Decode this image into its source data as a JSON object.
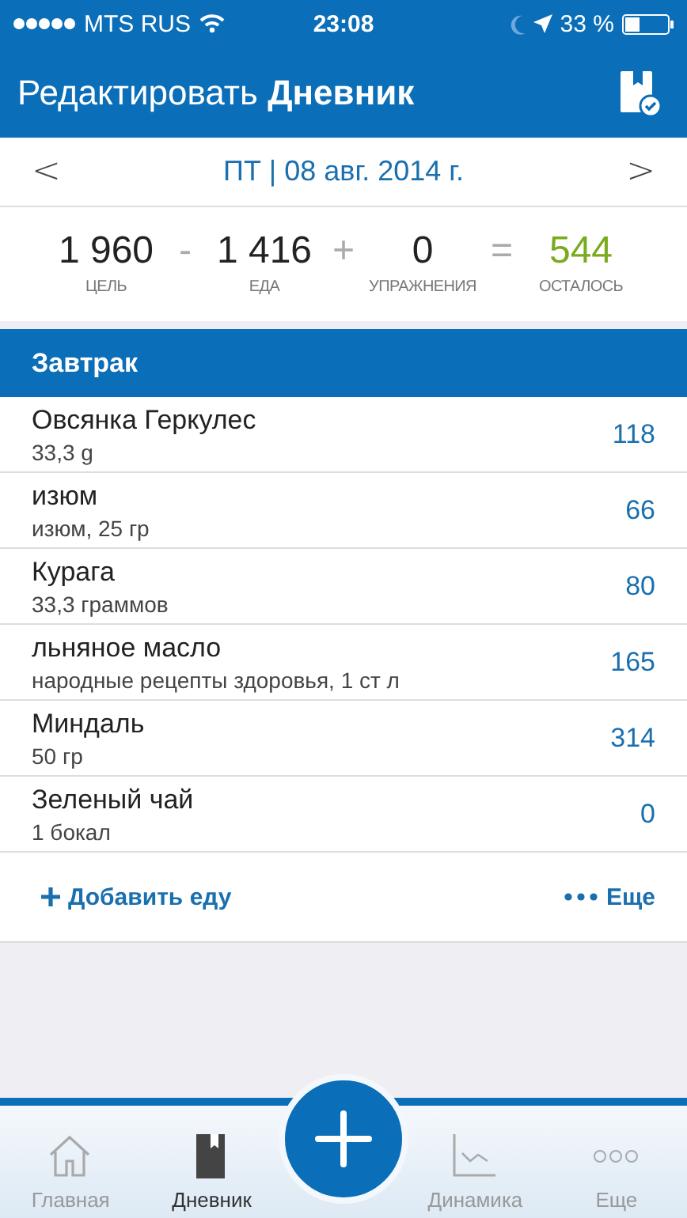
{
  "status_bar": {
    "carrier": "MTS RUS",
    "time": "23:08",
    "battery": "33 %"
  },
  "header": {
    "title": "Редактировать **Дневник**"
  },
  "date_bar": {
    "prev": "<",
    "date": "ПТ | 08 авг. 2014 г.",
    "next": ">"
  },
  "summary": [
    {
      "value": "1 960",
      "label": "ЦЕЛЬ",
      "color": "#222222",
      "operator": "-"
    },
    {
      "value": "1 416",
      "label": "ЕДА",
      "color": "#222222",
      "operator": "+"
    },
    {
      "value": "0",
      "label": "УПРАЖНЕНИЯ",
      "color": "#222222",
      "operator": "="
    },
    {
      "value": "544",
      "label": "ОСТАЛОСЬ",
      "color": "#7aaa1e"
    }
  ],
  "meal": {
    "title": "Завтрак",
    "items": [
      {
        "name": "Овсянка Геркулес",
        "portion": "33,3 g",
        "calories": "118"
      },
      {
        "name": "изюм",
        "portion": "изюм, 25 гр",
        "calories": "66"
      },
      {
        "name": "Курага",
        "portion": "33,3 граммов",
        "calories": "80"
      },
      {
        "name": "льняное масло",
        "portion": "народные рецепты здоровья, 1 ст л",
        "calories": "165"
      },
      {
        "name": "Миндаль",
        "portion": "50 гр",
        "calories": "314"
      },
      {
        "name": "Зеленый чай",
        "portion": "1 бокал",
        "calories": "0"
      }
    ],
    "add_button": "Добавить еду",
    "more_button": "Еще"
  },
  "tab_bar": [
    {
      "kind": "home",
      "label": "Главная",
      "selected": false
    },
    {
      "kind": "diary",
      "label": "Дневник",
      "selected": true
    },
    {
      "kind": "add",
      "selected": false
    },
    {
      "kind": "chart",
      "label": "Динамика",
      "selected": false
    },
    {
      "kind": "more",
      "label": "Еще",
      "selected": false
    }
  ]
}
